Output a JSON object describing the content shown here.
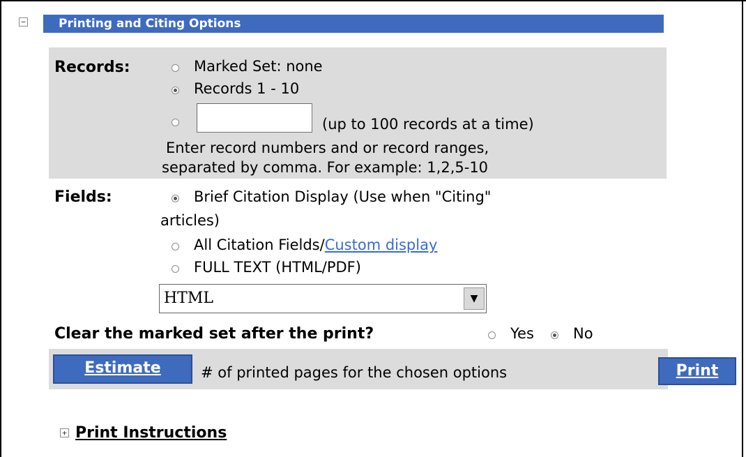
{
  "section": {
    "title": "Printing and Citing Options",
    "collapse_symbol": "−"
  },
  "records": {
    "label": "Records:",
    "options": {
      "marked_set": "Marked Set: none",
      "range": "Records 1 - 10",
      "custom_hint": "(up to 100 records at a time)"
    },
    "custom_input": {
      "value": "",
      "placeholder": ""
    },
    "help_line_1": "Enter record numbers and or record ranges,",
    "help_line_2": "separated by comma. For example: 1,2,5-10",
    "selected": "range"
  },
  "fields": {
    "label": "Fields:",
    "brief_line_1": "Brief Citation Display (Use when \"Citing\"",
    "brief_line_2": "articles)",
    "all_prefix": "All Citation Fields/",
    "custom_display_link": "Custom display",
    "full_text": "FULL TEXT (HTML/PDF)",
    "format_select_value": "HTML",
    "selected": "brief"
  },
  "clear_marked": {
    "question": "Clear the marked set after the print?",
    "yes_label": "Yes",
    "no_label": "No",
    "selected": "no"
  },
  "actions": {
    "estimate_label": "Estimate",
    "estimate_desc": "# of printed pages for the chosen options",
    "print_label": "Print"
  },
  "footer": {
    "expand_symbol": "+",
    "instructions_link": "Print Instructions"
  },
  "colors": {
    "header_blue": "#3f6bbf",
    "panel_gray": "#dcdcdc",
    "link_blue": "#3a6ad6"
  }
}
